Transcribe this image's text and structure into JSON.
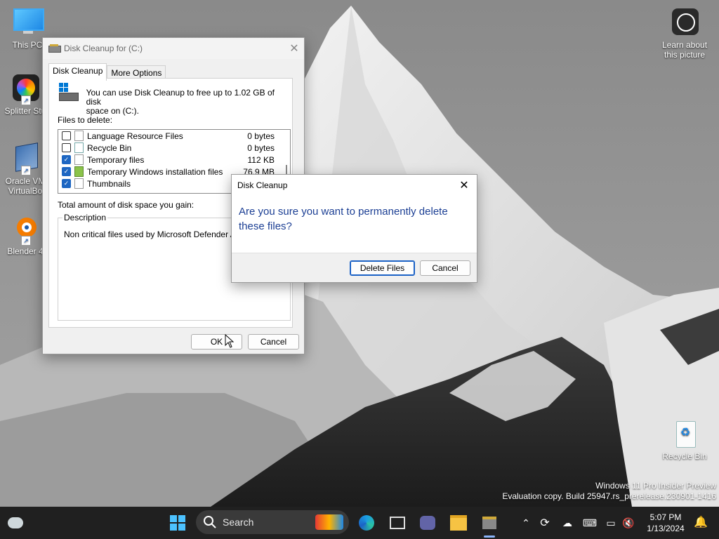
{
  "desktop": {
    "icons": [
      {
        "label": "This PC",
        "icon": "monitor-icon"
      },
      {
        "label": "Splitter Stu",
        "icon": "splitter-studio-icon"
      },
      {
        "label": "Oracle VM VirtualBo",
        "label_line1": "Oracle VM",
        "label_line2": "VirtualBo",
        "icon": "virtualbox-icon"
      },
      {
        "label": "Blender 4",
        "icon": "blender-icon"
      },
      {
        "label": "Recycle Bin",
        "icon": "recycle-bin-icon"
      }
    ],
    "learn": {
      "line1": "Learn about",
      "line2": "this picture",
      "icon": "camera-icon"
    },
    "watermark": {
      "line1": "Windows 11 Pro Insider Preview",
      "line2": "Evaluation copy. Build 25947.rs_prerelease.230901-1416"
    }
  },
  "cleanup_window": {
    "title": "Disk Cleanup for  (C:)",
    "tabs": [
      {
        "label": "Disk Cleanup",
        "active": true
      },
      {
        "label": "More Options",
        "active": false
      }
    ],
    "info_line1": "You can use Disk Cleanup to free up to 1.02 GB of disk",
    "info_line2": "space on  (C:).",
    "files_label": "Files to delete:",
    "files": [
      {
        "name": "Language Resource Files",
        "size": "0 bytes",
        "checked": false
      },
      {
        "name": "Recycle Bin",
        "size": "0 bytes",
        "checked": false
      },
      {
        "name": "Temporary files",
        "size": "112 KB",
        "checked": true
      },
      {
        "name": "Temporary Windows installation files",
        "size": "76.9 MB",
        "checked": true
      },
      {
        "name": "Thumbnails",
        "size": "",
        "checked": true
      }
    ],
    "total_label": "Total amount of disk space you gain:",
    "description_title": "Description",
    "description_text": "Non critical files used by Microsoft Defender Antivir",
    "ok_label": "OK",
    "cancel_label": "Cancel"
  },
  "confirm_dialog": {
    "title": "Disk Cleanup",
    "question_line1": "Are you sure you want to permanently delete",
    "question_line2": "these files?",
    "delete_label": "Delete Files",
    "cancel_label": "Cancel"
  },
  "taskbar": {
    "search_placeholder": "Search",
    "time": "5:07 PM",
    "date": "1/13/2024",
    "accent": "#1b62c6"
  }
}
